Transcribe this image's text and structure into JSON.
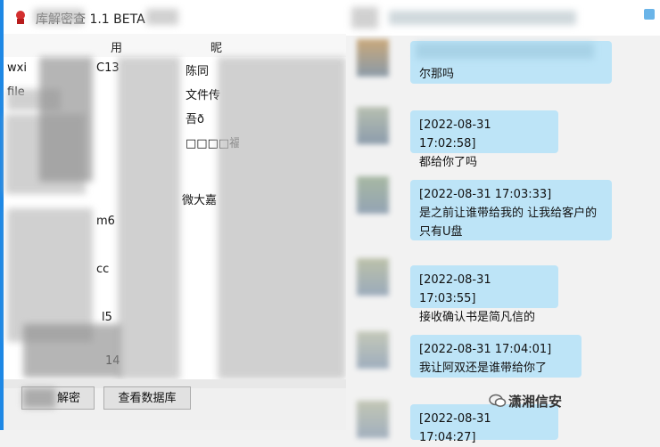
{
  "left_window": {
    "title": "库解密查 1.1 BETA",
    "columns": [
      "用",
      "昵"
    ],
    "rows": [
      {
        "c1": "wxi",
        "c2": "C13",
        "c3": "陈同"
      },
      {
        "c1": "file",
        "c2": "",
        "c3": "文件传"
      },
      {
        "c1": "",
        "c2": "",
        "c3": "吾ð"
      },
      {
        "c1": "",
        "c2": "",
        "c3": "□□□□福"
      },
      {
        "c1": "",
        "c2": "",
        "c3": ""
      },
      {
        "c1": "",
        "c2": "",
        "c3": "微大嘉"
      },
      {
        "c1": "",
        "c2": "m6",
        "c3": ""
      },
      {
        "c1": "",
        "c2": "",
        "c3": ""
      },
      {
        "c1": "",
        "c2": "cc",
        "c3": ""
      },
      {
        "c1": "",
        "c2": "",
        "c3": ""
      },
      {
        "c1": "",
        "c2": "l5",
        "c3": ""
      },
      {
        "c1": "",
        "c2": "",
        "c3": ""
      },
      {
        "c1": "",
        "c2": "14",
        "c3": ""
      }
    ],
    "decrypt_button": "解密",
    "view_db_button": "查看数据库"
  },
  "chat": {
    "messages": [
      {
        "time": "",
        "text": "尔那吗"
      },
      {
        "time": "[2022-08-31 17:02:58]",
        "text": "都给你了吗"
      },
      {
        "time": "[2022-08-31 17:03:33]",
        "text": "是之前让谁带给我的  让我给客户的  只有U盘"
      },
      {
        "time": "[2022-08-31 17:03:55]",
        "text": "接收确认书是简凡信的"
      },
      {
        "time": "[2022-08-31 17:04:01]",
        "text": "我让阿双还是谁带给你了"
      },
      {
        "time": "[2022-08-31 17:04:27]",
        "text": ""
      }
    ]
  },
  "watermark": "潇湘信安",
  "colors": {
    "accent": "#1e88e5",
    "bubble": "#bde4f7"
  }
}
